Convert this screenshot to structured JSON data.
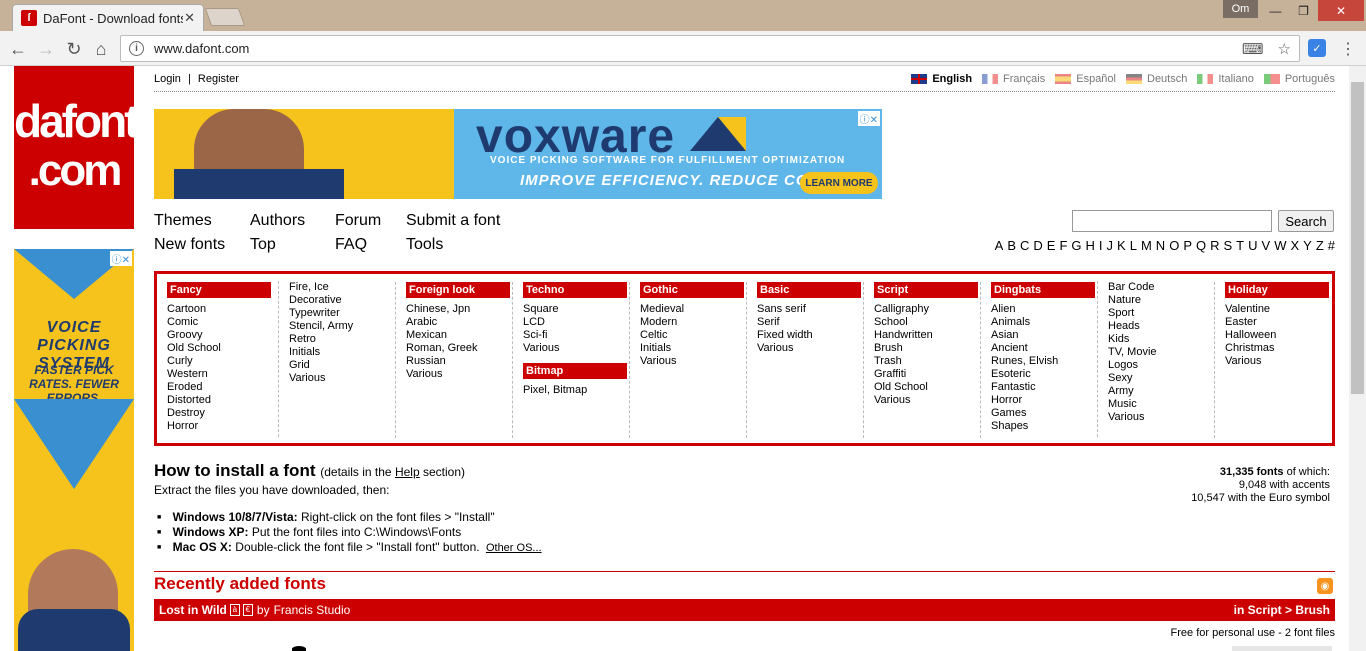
{
  "browser": {
    "tab_title": "DaFont - Download fonts",
    "tab_favicon": "dafont-favicon",
    "profile": "Om",
    "url": "www.dafont.com",
    "window_controls": [
      "—",
      "❐",
      "✕"
    ]
  },
  "header": {
    "logo_line1": "dafont",
    "logo_line2": ".com",
    "login": "Login",
    "register": "Register",
    "separator": "|",
    "languages": [
      {
        "label": "English",
        "active": true
      },
      {
        "label": "Français",
        "active": false
      },
      {
        "label": "Español",
        "active": false
      },
      {
        "label": "Deutsch",
        "active": false
      },
      {
        "label": "Italiano",
        "active": false
      },
      {
        "label": "Português",
        "active": false
      }
    ]
  },
  "banner_ad": {
    "brand": "voxware",
    "tagline": "VOICE PICKING SOFTWARE FOR FULFILLMENT OPTIMIZATION",
    "cta": "IMPROVE EFFICIENCY. REDUCE COSTS.",
    "button": "LEARN MORE"
  },
  "side_ad": {
    "headline": "VOICE PICKING SYSTEM",
    "subline": "FASTER PICK RATES. FEWER ERRORS."
  },
  "nav": {
    "themes": "Themes",
    "authors": "Authors",
    "forum": "Forum",
    "submit": "Submit a font",
    "new_fonts": "New fonts",
    "top": "Top",
    "faq": "FAQ",
    "tools": "Tools"
  },
  "search": {
    "button": "Search",
    "value": "",
    "placeholder": ""
  },
  "alphabet": [
    "A",
    "B",
    "C",
    "D",
    "E",
    "F",
    "G",
    "H",
    "I",
    "J",
    "K",
    "L",
    "M",
    "N",
    "O",
    "P",
    "Q",
    "R",
    "S",
    "T",
    "U",
    "V",
    "W",
    "X",
    "Y",
    "Z",
    "#"
  ],
  "categories": {
    "fancy": {
      "title": "Fancy",
      "items": [
        "Cartoon",
        "Comic",
        "Groovy",
        "Old School",
        "Curly",
        "Western",
        "Eroded",
        "Distorted",
        "Destroy",
        "Horror"
      ]
    },
    "fancy2": {
      "items": [
        "Fire, Ice",
        "Decorative",
        "Typewriter",
        "Stencil, Army",
        "Retro",
        "Initials",
        "Grid",
        "Various"
      ]
    },
    "foreign": {
      "title": "Foreign look",
      "items": [
        "Chinese, Jpn",
        "Arabic",
        "Mexican",
        "Roman, Greek",
        "Russian",
        "Various"
      ]
    },
    "techno": {
      "title": "Techno",
      "items": [
        "Square",
        "LCD",
        "Sci-fi",
        "Various"
      ]
    },
    "bitmap": {
      "title": "Bitmap",
      "items": [
        "Pixel, Bitmap"
      ]
    },
    "gothic": {
      "title": "Gothic",
      "items": [
        "Medieval",
        "Modern",
        "Celtic",
        "Initials",
        "Various"
      ]
    },
    "basic": {
      "title": "Basic",
      "items": [
        "Sans serif",
        "Serif",
        "Fixed width",
        "Various"
      ]
    },
    "script": {
      "title": "Script",
      "items": [
        "Calligraphy",
        "School",
        "Handwritten",
        "Brush",
        "Trash",
        "Graffiti",
        "Old School",
        "Various"
      ]
    },
    "dingbats": {
      "title": "Dingbats",
      "items": [
        "Alien",
        "Animals",
        "Asian",
        "Ancient",
        "Runes, Elvish",
        "Esoteric",
        "Fantastic",
        "Horror",
        "Games",
        "Shapes"
      ]
    },
    "dingbats2": {
      "items": [
        "Bar Code",
        "Nature",
        "Sport",
        "Heads",
        "Kids",
        "TV, Movie",
        "Logos",
        "Sexy",
        "Army",
        "Music",
        "Various"
      ]
    },
    "holiday": {
      "title": "Holiday",
      "items": [
        "Valentine",
        "Easter",
        "Halloween",
        "Christmas",
        "Various"
      ]
    }
  },
  "install": {
    "title": "How to install a font",
    "note_prefix": "(details in the",
    "note_link": "Help",
    "note_suffix": "section)",
    "subtitle": "Extract the files you have downloaded, then:",
    "steps": [
      {
        "os": "Windows 10/8/7/Vista:",
        "text": "Right-click on the font files > \"Install\""
      },
      {
        "os": "Windows XP:",
        "text": "Put the font files into C:\\Windows\\Fonts"
      },
      {
        "os": "Mac OS X:",
        "text": "Double-click the font file > \"Install font\" button."
      }
    ],
    "other_os": "Other OS..."
  },
  "stats": {
    "total": "31,335 fonts",
    "total_suffix": "of which:",
    "accents": "9,048 with accents",
    "euro": "10,547 with the Euro symbol"
  },
  "recent": {
    "title": "Recently added fonts",
    "font_name": "Lost in Wild",
    "by": "by",
    "author": "Francis Studio",
    "category": "in Script > Brush",
    "license": "Free for personal use - 2 font files"
  },
  "colors": {
    "brand_red": "#cc0000",
    "ad_yellow": "#f6c31c",
    "ad_blue": "#1e3a6e"
  }
}
